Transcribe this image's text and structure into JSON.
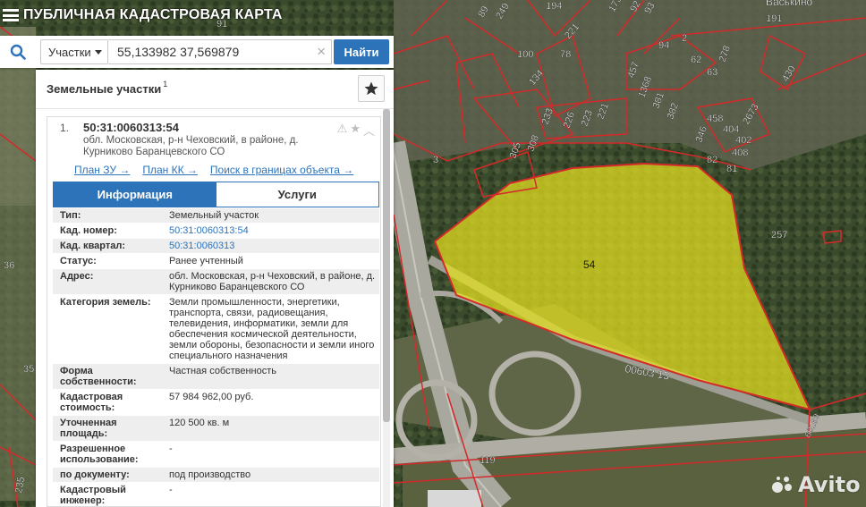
{
  "header": {
    "title": "ПУБЛИЧНАЯ КАДАСТРОВАЯ КАРТА"
  },
  "search": {
    "type_label": "Участки",
    "query": "55,133982 37,569879",
    "submit_label": "Найти",
    "clear_glyph": "×"
  },
  "panel": {
    "title": "Земельные участки",
    "count": "1",
    "result": {
      "number": "1.",
      "cadastral_number": "50:31:0060313:54",
      "address": "обл. Московская, р-н Чеховский, в районе, д. Курниково Баранцевского СО",
      "links": [
        "План ЗУ →",
        "План КК →",
        "Поиск в границах объекта →"
      ]
    },
    "tabs": [
      "Информация",
      "Услуги"
    ],
    "info_rows": [
      {
        "key": "Тип:",
        "value": "Земельный участок",
        "link": false
      },
      {
        "key": "Кад. номер:",
        "value": "50:31:0060313:54",
        "link": true
      },
      {
        "key": "Кад. квартал:",
        "value": "50:31:0060313",
        "link": true
      },
      {
        "key": "Статус:",
        "value": "Ранее учтенный",
        "link": false
      },
      {
        "key": "Адрес:",
        "value": "обл. Московская, р-н Чеховский, в районе, д. Курниково Баранцевского СО",
        "link": false
      },
      {
        "key": "Категория земель:",
        "value": "Земли промышленности, энергетики, транспорта, связи, радиовещания, телевидения, информатики, земли для обеспечения космической деятельности, земли обороны, безопасности и земли иного специального назначения",
        "link": false
      },
      {
        "key": "Форма собственности:",
        "value": "Частная собственность",
        "link": false
      },
      {
        "key": "Кадастровая стоимость:",
        "value": "57 984 962,00 руб.",
        "link": false
      },
      {
        "key": "Уточненная площадь:",
        "value": "120 500 кв. м",
        "link": false
      },
      {
        "key": "Разрешенное использование:",
        "value": "-",
        "link": false
      },
      {
        "key": "по документу:",
        "value": "под производство",
        "link": false
      },
      {
        "key": "Кадастровый инженер:",
        "value": "-",
        "link": false
      }
    ]
  },
  "map": {
    "parcel_label": "54",
    "quarter_label": "00603 13",
    "road_label": "119",
    "road2_label": "60169",
    "village_label": "Васькино",
    "labels": [
      "91",
      "3",
      "36",
      "35",
      "78",
      "221",
      "226",
      "257",
      "430",
      "2",
      "62",
      "63",
      "94",
      "278",
      "457",
      "1368",
      "381",
      "382",
      "458",
      "404",
      "402",
      "2673",
      "346",
      "408",
      "82",
      "81",
      "100",
      "134",
      "233",
      "226",
      "223",
      "221",
      "308",
      "305",
      "89",
      "249",
      "194",
      "191",
      "173",
      "92",
      "93",
      "235"
    ]
  },
  "watermark": {
    "text": "Avito"
  },
  "colors": {
    "accent": "#2d73b9",
    "parcel_fill": "#e6e21f",
    "boundary": "#d42a2a"
  }
}
